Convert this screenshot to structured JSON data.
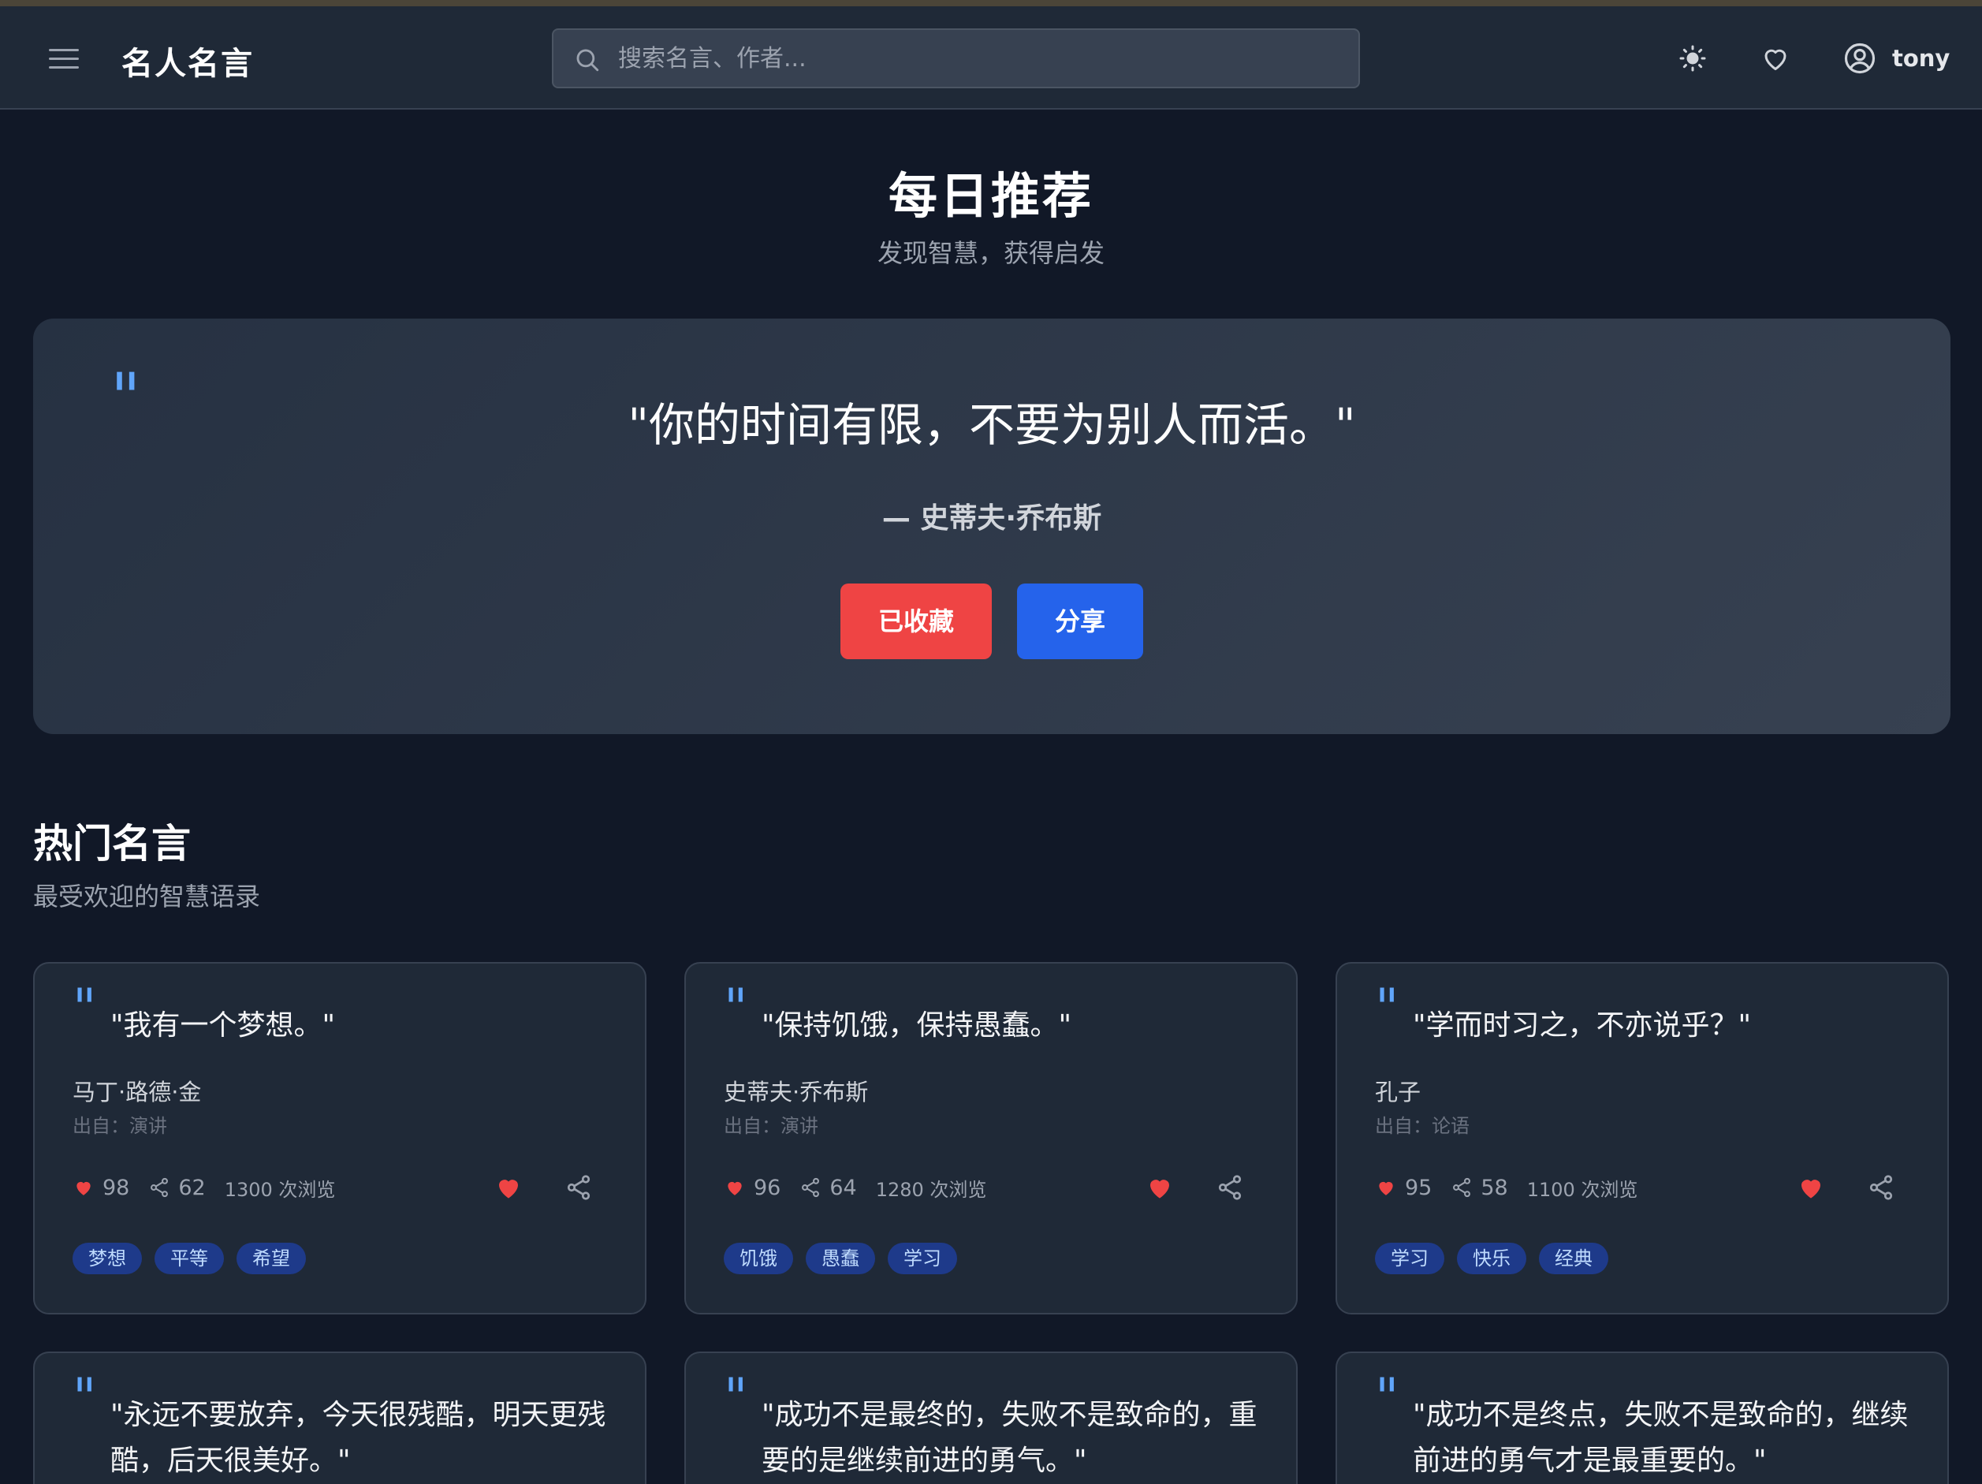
{
  "header": {
    "brand": "名人名言",
    "search_placeholder": "搜索名言、作者...",
    "username": "tony"
  },
  "daily": {
    "title": "每日推荐",
    "subtitle": "发现智慧，获得启发"
  },
  "featured": {
    "quote": "\"你的时间有限，不要为别人而活。\"",
    "author": "— 史蒂夫·乔布斯",
    "favorite_label": "已收藏",
    "share_label": "分享"
  },
  "popular": {
    "title": "热门名言",
    "subtitle": "最受欢迎的智慧语录",
    "cards": [
      {
        "quote": "\"我有一个梦想。\"",
        "author": "马丁·路德·金",
        "source": "出自：演讲",
        "likes": "98",
        "shares": "62",
        "views": "1300 次浏览",
        "tags": [
          "梦想",
          "平等",
          "希望"
        ]
      },
      {
        "quote": "\"保持饥饿，保持愚蠢。\"",
        "author": "史蒂夫·乔布斯",
        "source": "出自：演讲",
        "likes": "96",
        "shares": "64",
        "views": "1280 次浏览",
        "tags": [
          "饥饿",
          "愚蠢",
          "学习"
        ]
      },
      {
        "quote": "\"学而时习之，不亦说乎？\"",
        "author": "孔子",
        "source": "出自：论语",
        "likes": "95",
        "shares": "58",
        "views": "1100 次浏览",
        "tags": [
          "学习",
          "快乐",
          "经典"
        ]
      },
      {
        "quote": "\"永远不要放弃，今天很残酷，明天更残酷，后天很美好。\""
      },
      {
        "quote": "\"成功不是最终的，失败不是致命的，重要的是继续前进的勇气。\""
      },
      {
        "quote": "\"成功不是终点，失败不是致命的，继续前进的勇气才是最重要的。\""
      }
    ]
  },
  "colors": {
    "background": "#111827",
    "surface": "#1f2937",
    "accent_blue": "#2563eb",
    "favorite_red": "#ef4444",
    "quote_mark": "#60a5fa"
  },
  "icons": [
    "menu-icon",
    "search-icon",
    "theme-sun-icon",
    "favorites-heart-icon",
    "user-circle-icon",
    "heart-icon",
    "share-icon"
  ]
}
